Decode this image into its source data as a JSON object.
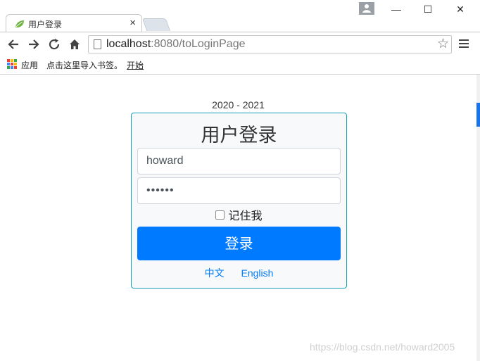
{
  "browser": {
    "tab_title": "用户登录",
    "tab_close": "×",
    "window_minimize": "—",
    "window_maximize": "☐",
    "window_close": "✕",
    "url_host": "localhost",
    "url_rest": ":8080/toLoginPage",
    "bookmarks": {
      "apps_label": "应用",
      "import_label": "点击这里导入书签。",
      "start_label": "开始"
    }
  },
  "page": {
    "year_range": "2020 - 2021",
    "title": "用户登录",
    "username_value": "howard",
    "password_value": "••••••",
    "remember_label": "记住我",
    "login_button": "登录",
    "lang_zh": "中文",
    "lang_en": "English"
  },
  "watermark": "https://blog.csdn.net/howard2005",
  "colors": {
    "primary": "#007bff",
    "card_border": "#17a2b8"
  }
}
